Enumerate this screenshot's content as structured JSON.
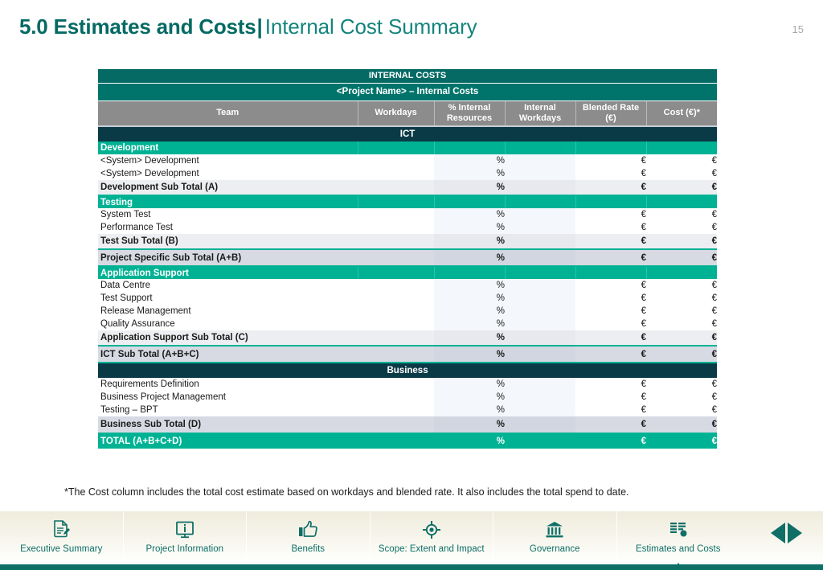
{
  "header": {
    "title_main": "5.0 Estimates and Costs",
    "title_pipe": "|",
    "title_sub": "Internal Cost Summary",
    "page_number": "15",
    "accent_color": "#046A63"
  },
  "table": {
    "banner_top": "INTERNAL COSTS",
    "banner_project": "<Project Name> – Internal Costs",
    "columns": [
      {
        "label": "Team"
      },
      {
        "label": "Workdays"
      },
      {
        "label": "% Internal Resources"
      },
      {
        "label": "Internal Workdays"
      },
      {
        "label": "Blended Rate (€)"
      },
      {
        "label": "Cost (€)*"
      }
    ],
    "column_labels_wrapped": {
      "team": "Team",
      "workdays": "Workdays",
      "pct_internal_line1": "% Internal",
      "pct_internal_line2": "Resources",
      "internal_wd_line1": "Internal",
      "internal_wd_line2": "Workdays",
      "blended_line1": "Blended Rate",
      "blended_line2": "(€)",
      "cost": "Cost (€)*"
    },
    "symbols": {
      "percent": "%",
      "euro": "€",
      "empty": ""
    },
    "groups": [
      {
        "name": "ICT",
        "sections": [
          {
            "name": "Development",
            "rows": [
              {
                "team": "<System> Development",
                "workdays": "",
                "pct": "%",
                "internal_workdays": "",
                "rate": "€",
                "cost": "€"
              },
              {
                "team": "<System> Development",
                "workdays": "",
                "pct": "%",
                "internal_workdays": "",
                "rate": "€",
                "cost": "€"
              }
            ],
            "subtotal": {
              "team": "Development Sub Total (A)",
              "workdays": "",
              "pct": "%",
              "internal_workdays": "",
              "rate": "€",
              "cost": "€"
            }
          },
          {
            "name": "Testing",
            "rows": [
              {
                "team": "System Test",
                "workdays": "",
                "pct": "%",
                "internal_workdays": "",
                "rate": "€",
                "cost": "€"
              },
              {
                "team": "Performance Test",
                "workdays": "",
                "pct": "%",
                "internal_workdays": "",
                "rate": "€",
                "cost": "€"
              }
            ],
            "subtotal": {
              "team": "Test Sub Total (B)",
              "workdays": "",
              "pct": "%",
              "internal_workdays": "",
              "rate": "€",
              "cost": "€"
            }
          }
        ],
        "combined_subtotal": {
          "team": "Project Specific Sub Total (A+B)",
          "workdays": "",
          "pct": "%",
          "internal_workdays": "",
          "rate": "€",
          "cost": "€"
        },
        "section_app": {
          "name": "Application Support",
          "rows": [
            {
              "team": "Data Centre",
              "workdays": "",
              "pct": "%",
              "internal_workdays": "",
              "rate": "€",
              "cost": "€"
            },
            {
              "team": "Test Support",
              "workdays": "",
              "pct": "%",
              "internal_workdays": "",
              "rate": "€",
              "cost": "€"
            },
            {
              "team": "Release Management",
              "workdays": "",
              "pct": "%",
              "internal_workdays": "",
              "rate": "€",
              "cost": "€"
            },
            {
              "team": "Quality Assurance",
              "workdays": "",
              "pct": "%",
              "internal_workdays": "",
              "rate": "€",
              "cost": "€"
            }
          ],
          "subtotal": {
            "team": "Application Support Sub Total (C)",
            "workdays": "",
            "pct": "%",
            "internal_workdays": "",
            "rate": "€",
            "cost": "€"
          }
        },
        "group_subtotal": {
          "team": "ICT Sub Total (A+B+C)",
          "workdays": "",
          "pct": "%",
          "internal_workdays": "",
          "rate": "€",
          "cost": "€"
        }
      },
      {
        "name": "Business",
        "rows": [
          {
            "team": "Requirements Definition",
            "workdays": "",
            "pct": "%",
            "internal_workdays": "",
            "rate": "€",
            "cost": "€"
          },
          {
            "team": "Business Project Management",
            "workdays": "",
            "pct": "%",
            "internal_workdays": "",
            "rate": "€",
            "cost": "€"
          },
          {
            "team": "Testing – BPT",
            "workdays": "",
            "pct": "%",
            "internal_workdays": "",
            "rate": "€",
            "cost": "€"
          }
        ],
        "subtotal": {
          "team": "Business Sub Total (D)",
          "workdays": "",
          "pct": "%",
          "internal_workdays": "",
          "rate": "€",
          "cost": "€"
        }
      }
    ],
    "grand_total": {
      "team": "TOTAL (A+B+C+D)",
      "workdays": "",
      "pct": "%",
      "internal_workdays": "",
      "rate": "€",
      "cost": "€"
    }
  },
  "footnote": "*The Cost column includes the total cost estimate based on workdays and blended rate. It also includes the total spend to date.",
  "nav": {
    "items": [
      {
        "label": "Executive Summary",
        "icon": "document-pencil-icon",
        "active": false
      },
      {
        "label": "Project Information",
        "icon": "monitor-info-icon",
        "active": false
      },
      {
        "label": "Benefits",
        "icon": "thumbs-up-icon",
        "active": false
      },
      {
        "label": "Scope: Extent and Impact",
        "icon": "target-crosshair-icon",
        "active": false
      },
      {
        "label": "Governance",
        "icon": "bank-columns-icon",
        "active": false
      },
      {
        "label": "Estimates and Costs",
        "icon": "bar-chart-icon",
        "active": true
      }
    ],
    "prev_label": "Previous slide",
    "next_label": "Next slide",
    "accent_color": "#0E6F67"
  }
}
